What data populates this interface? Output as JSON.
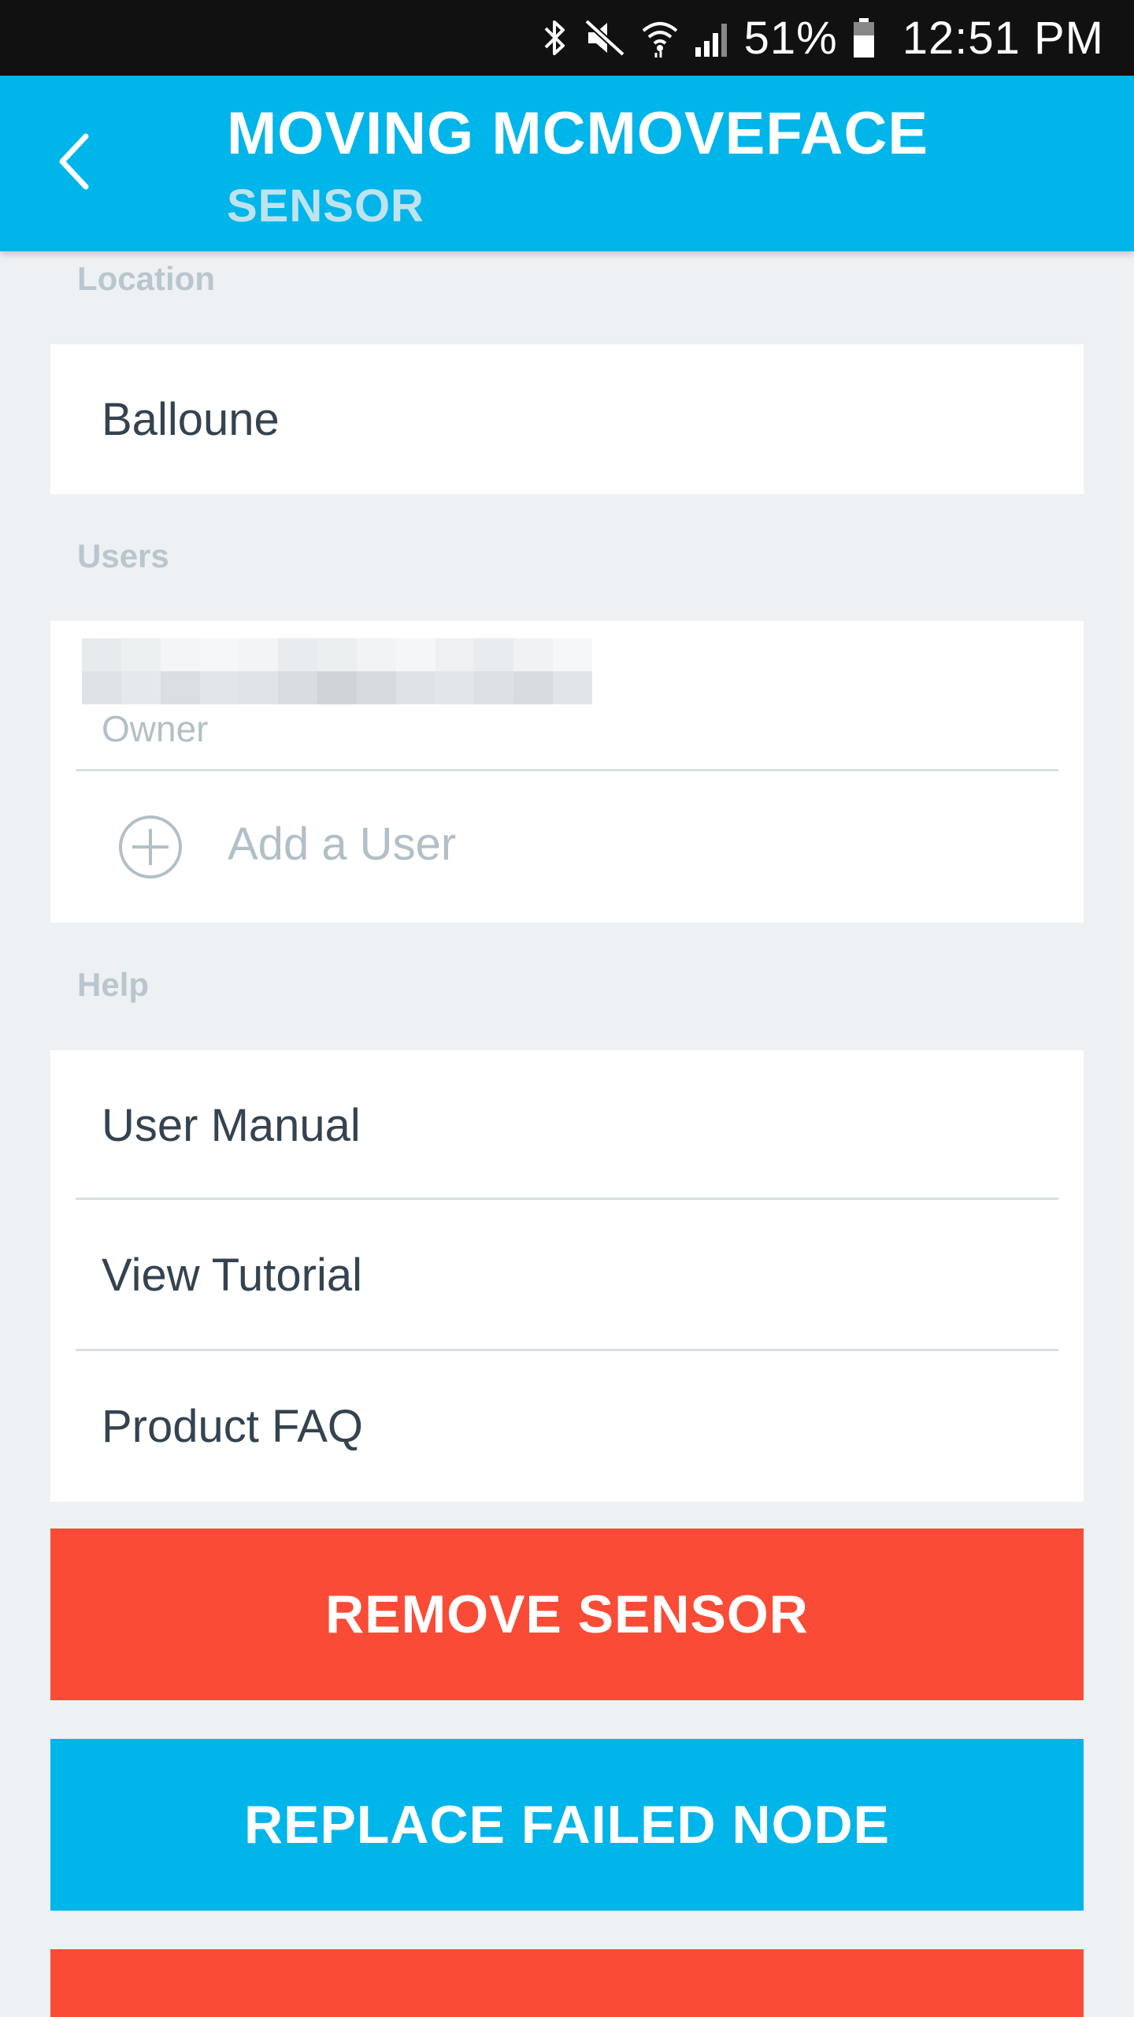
{
  "status_bar": {
    "battery": "51%",
    "time": "12:51 PM",
    "icons": [
      "bluetooth-icon",
      "mute-icon",
      "wifi-icon",
      "signal-icon",
      "battery-icon"
    ]
  },
  "header": {
    "title": "MOVING MCMOVEFACE",
    "subtitle": "SENSOR",
    "back_icon": "chevron-left-icon",
    "color": "#00b5ea"
  },
  "location": {
    "label": "Location",
    "value": "Balloune"
  },
  "users": {
    "label": "Users",
    "items": [
      {
        "name": "",
        "role": "Owner"
      }
    ],
    "add_label": "Add a User",
    "add_icon": "plus-circle-icon"
  },
  "help": {
    "label": "Help",
    "items": [
      {
        "label": "User Manual"
      },
      {
        "label": "View Tutorial"
      },
      {
        "label": "Product FAQ"
      }
    ]
  },
  "actions": {
    "remove_label": "REMOVE SENSOR",
    "replace_label": "REPLACE FAILED NODE",
    "remove_color": "#fa4b36",
    "replace_color": "#00b5ea"
  }
}
